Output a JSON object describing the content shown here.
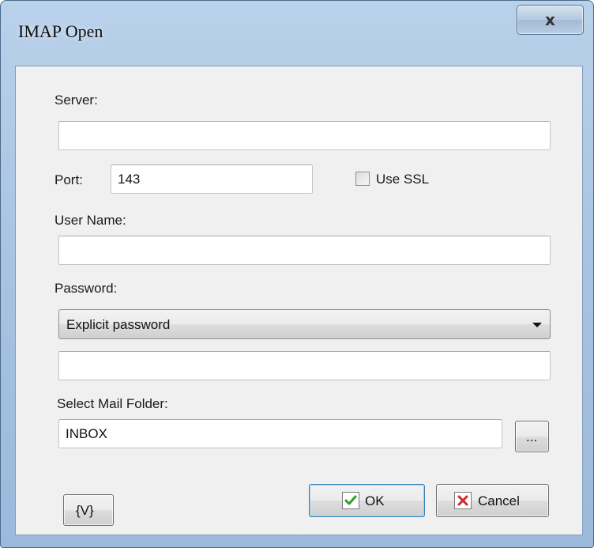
{
  "window": {
    "title": "IMAP Open",
    "close_glyph": "x"
  },
  "form": {
    "server_label": "Server:",
    "server_value": "",
    "port_label": "Port:",
    "port_value": "143",
    "use_ssl_label": "Use SSL",
    "use_ssl_checked": false,
    "user_name_label": "User Name:",
    "user_name_value": "",
    "password_label": "Password:",
    "password_mode": "Explicit password",
    "password_value": "",
    "folder_label": "Select Mail Folder:",
    "folder_value": "INBOX",
    "browse_label": "..."
  },
  "buttons": {
    "variables_label": "{V}",
    "ok_label": "OK",
    "cancel_label": "Cancel"
  },
  "icons": {
    "ok": "check-icon",
    "cancel": "cross-icon",
    "close": "close-icon",
    "dropdown": "chevron-down-icon"
  },
  "colors": {
    "frame": "#a9c4e2",
    "client_bg": "#f0f0f0",
    "ok_check": "#2e9b2e",
    "cancel_cross": "#d42a2a"
  }
}
